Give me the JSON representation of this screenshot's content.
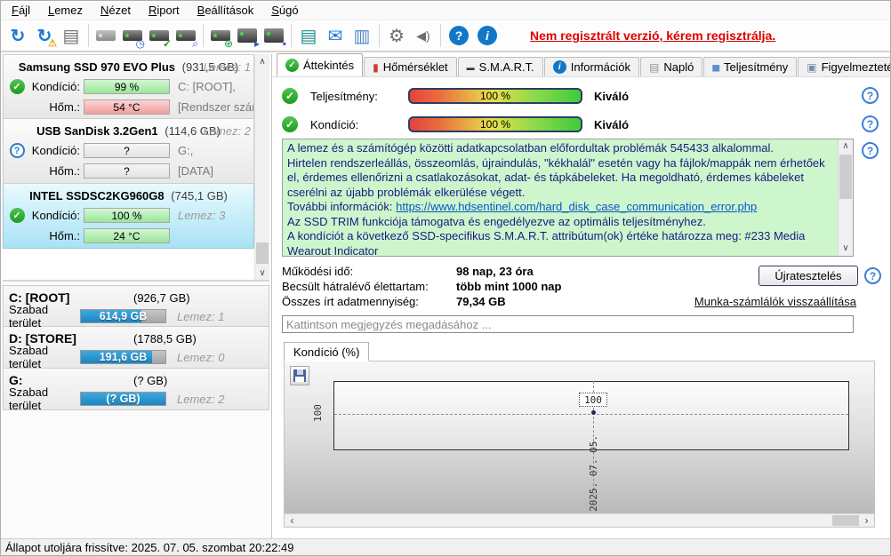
{
  "icons": {
    "check": "✓",
    "question": "?",
    "warning": "⚠",
    "refresh": "↻",
    "report": "▤",
    "clock": "◷",
    "search": "⌕",
    "globe": "⊕",
    "eject": "▸",
    "box": "▪",
    "notepad": "▤",
    "mail": "✉",
    "network": "▥",
    "gear": "⚙",
    "speaker": "◀)",
    "help": "?",
    "info": "i",
    "up": "∧",
    "down": "∨",
    "left": "‹",
    "right": "›",
    "thermometer": "▮",
    "smart": "▬",
    "log": "▤",
    "performance": "▅",
    "alerts": "▣"
  },
  "menu": {
    "items": [
      "Fájl",
      "Lemez",
      "Nézet",
      "Riport",
      "Beállítások",
      "Súgó"
    ]
  },
  "toolbar": {
    "registration_notice": "Nem regisztrált verzió, kérem regisztrálja."
  },
  "tabs": {
    "items": [
      {
        "label": "Áttekintés"
      },
      {
        "label": "Hőmérséklet"
      },
      {
        "label": "S.M.A.R.T."
      },
      {
        "label": "Információk"
      },
      {
        "label": "Napló"
      },
      {
        "label": "Teljesítmény"
      },
      {
        "label": "Figyelmeztetések"
      }
    ]
  },
  "sidebar": {
    "disks": [
      {
        "title": "Samsung SSD 970 EVO Plus",
        "size": "(931,5 GB)",
        "disk_label": "Lemez: 1",
        "condition_label": "Kondíció:",
        "condition_value": "99 %",
        "condition_extra": "C: [ROOT],",
        "temp_label": "Hőm.:",
        "temp_value": "54 °C",
        "temp_extra": "[Rendszer számár"
      },
      {
        "title": "USB SanDisk 3.2Gen1",
        "size": "(114,6 GB)",
        "disk_label": "Lemez: 2",
        "condition_label": "Kondíció:",
        "condition_value": "?",
        "condition_extra": "G:,",
        "temp_label": "Hőm.:",
        "temp_value": "?",
        "temp_extra": "[DATA]"
      },
      {
        "title": "INTEL SSDSC2KG960G8",
        "size": "(745,1 GB)",
        "disk_label": "Lemez: 3",
        "condition_label": "Kondíció:",
        "condition_value": "100 %",
        "condition_extra": "",
        "temp_label": "Hőm.:",
        "temp_value": "24 °C",
        "temp_extra": ""
      }
    ],
    "partitions": [
      {
        "name": "C: [ROOT]",
        "size": "(926,7 GB)",
        "free_label": "Szabad terület",
        "free_value": "614,9 GB",
        "disk_label": "Lemez: 1"
      },
      {
        "name": "D: [STORE]",
        "size": "(1788,5 GB)",
        "free_label": "Szabad terület",
        "free_value": "191,6 GB",
        "disk_label": "Lemez: 0"
      },
      {
        "name": "G:",
        "size": "(? GB)",
        "free_label": "Szabad terület",
        "free_value": "(? GB)",
        "disk_label": "Lemez: 2"
      }
    ]
  },
  "overview": {
    "rows": [
      {
        "label": "Teljesítmény:",
        "value": "100 %",
        "rating": "Kiváló"
      },
      {
        "label": "Kondíció:",
        "value": "100 %",
        "rating": "Kiváló"
      }
    ],
    "message": {
      "p1": "A lemez és a számítógép közötti adatkapcsolatban előfordultak problémák 545433 alkalommal.",
      "p2": "Hirtelen rendszerleállás, összeomlás, újraindulás, \"kékhalál\" esetén vagy ha fájlok/mappák nem érhetőek el, érdemes ellenőrizni a csatlakozásokat, adat- és tápkábeleket. Ha megoldható, érdemes kábeleket cserélni az újabb problémák elkerülése végett.",
      "p3_prefix": "További információk: ",
      "p3_link": "https://www.hdsentinel.com/hard_disk_case_communication_error.php",
      "p4": "Az SSD TRIM funkciója támogatva és engedélyezve az optimális teljesítményhez.",
      "p5": "A kondíciót a következő SSD-specifikus S.M.A.R.T. attribútum(ok) értéke határozza meg:  #233 Media Wearout Indicator"
    },
    "stats": [
      {
        "label": "Működési idő:",
        "value": "98 nap, 23 óra"
      },
      {
        "label": "Becsült hátralévő élettartam:",
        "value": "több mint 1000 nap"
      },
      {
        "label": "Összes írt adatmennyiség:",
        "value": "79,34 GB"
      }
    ],
    "retest_button": "Újratesztelés",
    "reset_link": "Munka-számlálók visszaállítása",
    "comment_placeholder": "Kattintson megjegyzés megadásához ..."
  },
  "chart": {
    "tab_label": "Kondíció  (%)"
  },
  "chart_data": {
    "type": "line",
    "title": "Kondíció (%)",
    "x": [
      "2025. 07. 05."
    ],
    "series": [
      {
        "name": "Kondíció",
        "values": [
          100
        ]
      }
    ],
    "yticks": [
      "100"
    ],
    "point_labels": [
      "100"
    ],
    "ylim": [
      0,
      100
    ],
    "grid": "dashed"
  },
  "status_bar": {
    "text": "Állapot utoljára frissítve: 2025. 07. 05. szombat 20:22:49"
  },
  "colors": {
    "accent_blue": "#1277c6",
    "alert_red": "#dd0000",
    "ok_green": "#1d9b1d",
    "tip_bg": "#cdf6cc",
    "free_bar_blue": "#1a85c2",
    "selected_disk_bg": "#a9e2f5"
  }
}
